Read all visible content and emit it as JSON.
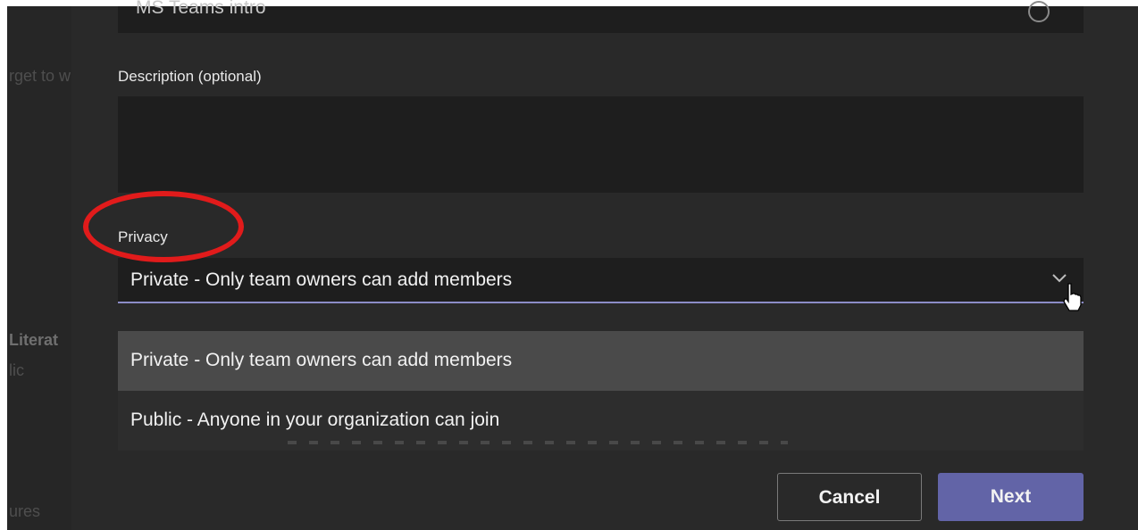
{
  "background": {
    "left_text_1": "rget to w",
    "left_text_2": "Literat",
    "left_text_3": "lic",
    "left_text_4": "ures"
  },
  "form": {
    "team_name_value": "MS Teams intro",
    "description_label": "Description (optional)",
    "description_value": "",
    "privacy_label": "Privacy",
    "privacy_selected": "Private - Only team owners can add members",
    "privacy_options": [
      "Private - Only team owners can add members",
      "Public - Anyone in your organization can join"
    ]
  },
  "buttons": {
    "cancel_label": "Cancel",
    "next_label": "Next"
  },
  "colors": {
    "accent": "#6264a7",
    "annotation": "#e11b1b",
    "dialog_bg": "#292929",
    "field_bg": "#1e1e1e"
  },
  "icons": {
    "name_field_status": "check-circle-icon",
    "dropdown": "chevron-down-icon",
    "pointer": "hand-cursor-icon"
  }
}
